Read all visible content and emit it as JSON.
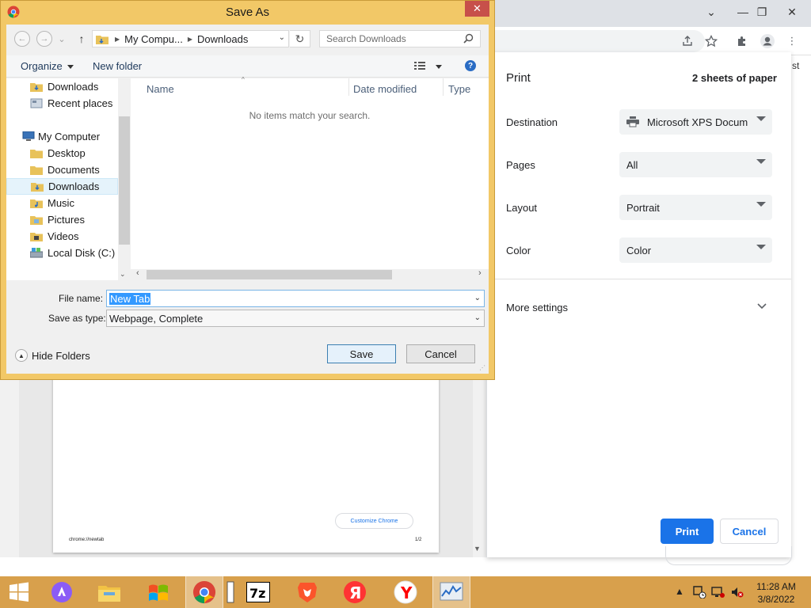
{
  "dialog": {
    "title": "Save As",
    "address": [
      "My Compu...",
      "Downloads"
    ],
    "search_placeholder": "Search Downloads",
    "organize_label": "Organize",
    "new_folder_label": "New folder",
    "tree": {
      "favorites": [
        "Downloads",
        "Recent places"
      ],
      "computer_label": "My Computer",
      "computer_items": [
        "Desktop",
        "Documents",
        "Downloads",
        "Music",
        "Pictures",
        "Videos",
        "Local Disk (C:)"
      ],
      "selected": "Downloads"
    },
    "columns": [
      "Name",
      "Date modified",
      "Type"
    ],
    "empty_message": "No items match your search.",
    "file_name_label": "File name:",
    "file_name_value": "New Tab",
    "save_as_type_label": "Save as type:",
    "save_as_type_value": "Webpage, Complete",
    "hide_folders_label": "Hide Folders",
    "save_label": "Save",
    "cancel_label": "Cancel"
  },
  "print_panel": {
    "title": "Print",
    "sheets": "2 sheets of paper",
    "destination_label": "Destination",
    "destination_value": "Microsoft XPS Docum",
    "pages_label": "Pages",
    "pages_value": "All",
    "layout_label": "Layout",
    "layout_value": "Portrait",
    "color_label": "Color",
    "color_value": "Color",
    "more_settings_label": "More settings",
    "print_label": "Print",
    "cancel_label": "Cancel"
  },
  "preview": {
    "customize_label": "Customize Chrome",
    "url": "chrome://newtab",
    "page_number": "1/2"
  },
  "chrome": {
    "bookmark_fragment": "st"
  },
  "taskbar": {
    "time": "11:28 AM",
    "date": "3/8/2022",
    "apps": [
      "windows-start",
      "alice-assistant",
      "file-explorer",
      "windows-media",
      "chrome",
      "notepad",
      "7zip",
      "brave",
      "yandex-browser",
      "yandex",
      "resource-monitor"
    ]
  },
  "colors": {
    "dialog_frame": "#f2c867",
    "taskbar": "#d8a04c",
    "accent_blue": "#1a73e8",
    "close_red": "#c7504a"
  }
}
